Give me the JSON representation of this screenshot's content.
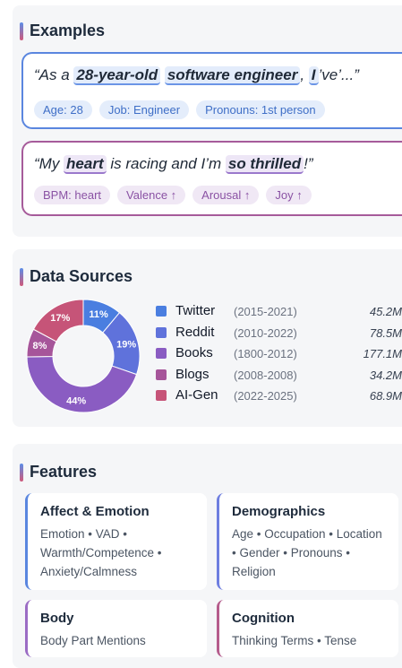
{
  "examples": {
    "heading": "Examples",
    "items": [
      {
        "quote_parts": [
          {
            "text": "“As a ",
            "hl": false
          },
          {
            "text": "28-year-old",
            "hl": true
          },
          {
            "text": " ",
            "hl": false
          },
          {
            "text": "software engineer",
            "hl": true
          },
          {
            "text": ", ",
            "hl": false
          },
          {
            "text": "I",
            "hl": true
          },
          {
            "text": "’ve’...”",
            "hl": false
          }
        ],
        "tags": [
          "Age: 28",
          "Job: Engineer",
          "Pronouns: 1st person"
        ],
        "accent": "#5a86df"
      },
      {
        "quote_parts": [
          {
            "text": "“My ",
            "hl": false
          },
          {
            "text": "heart",
            "hl": true
          },
          {
            "text": " is racing and I’m ",
            "hl": false
          },
          {
            "text": "so thrilled",
            "hl": true
          },
          {
            "text": "!”",
            "hl": false
          }
        ],
        "tags": [
          "BPM: heart",
          "Valence ↑",
          "Arousal ↑",
          "Joy ↑"
        ],
        "accent": "#a65b9a"
      }
    ]
  },
  "data_sources": {
    "heading": "Data Sources",
    "sources": [
      {
        "name": "Twitter",
        "years": "(2015-2021)",
        "size": "45.2M",
        "color": "#4a7ee0"
      },
      {
        "name": "Reddit",
        "years": "(2010-2022)",
        "size": "78.5M",
        "color": "#5f72db"
      },
      {
        "name": "Books",
        "years": "(1800-2012)",
        "size": "177.1M",
        "color": "#8a5cc2"
      },
      {
        "name": "Blogs",
        "years": "(2008-2008)",
        "size": "34.2M",
        "color": "#a6559a"
      },
      {
        "name": "AI-Gen",
        "years": "(2022-2025)",
        "size": "68.9M",
        "color": "#c65478"
      }
    ]
  },
  "chart_data": {
    "type": "pie",
    "categories": [
      "Twitter",
      "Reddit",
      "Books",
      "Blogs",
      "AI-Gen"
    ],
    "values": [
      11,
      19,
      44,
      8,
      17
    ],
    "labels": [
      "11%",
      "19%",
      "44%",
      "8%",
      "17%"
    ],
    "colors": [
      "#4a7ee0",
      "#5f72db",
      "#8a5cc2",
      "#a6559a",
      "#c65478"
    ],
    "donut": true
  },
  "features": {
    "heading": "Features",
    "cards": [
      {
        "title": "Affect & Emotion",
        "body": "Emotion • VAD • Warmth/Competence • Anxiety/Calmness"
      },
      {
        "title": "Demographics",
        "body": "Age • Occupation • Location • Gender • Pronouns • Religion"
      },
      {
        "title": "Body",
        "body": "Body Part Mentions"
      },
      {
        "title": "Cognition",
        "body": "Thinking Terms • Tense"
      }
    ]
  }
}
